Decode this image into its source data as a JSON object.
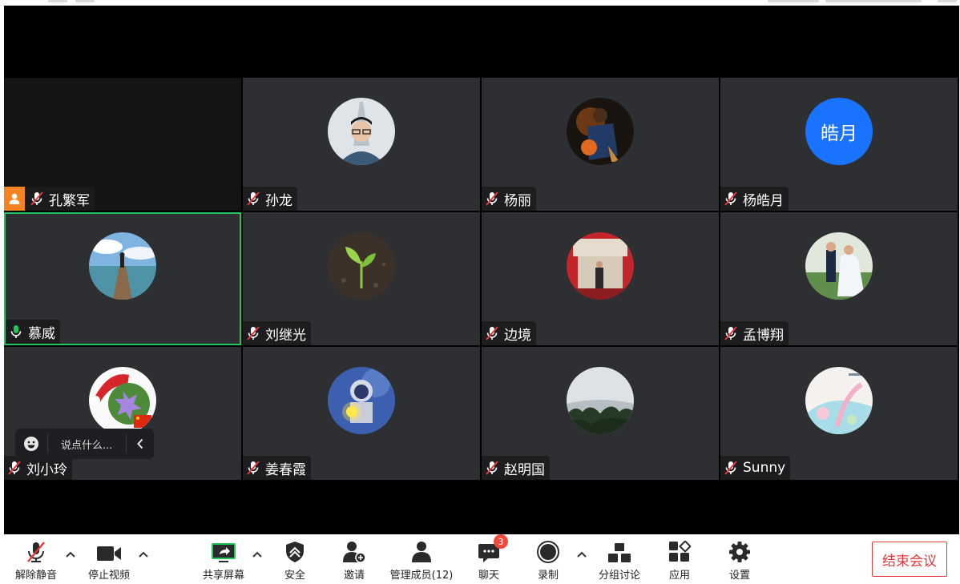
{
  "participants": [
    {
      "name": "孔繁军",
      "mic": "muted",
      "avatar": "none",
      "host_badge": true
    },
    {
      "name": "孙龙",
      "mic": "muted",
      "avatar": "photo-man-glasses"
    },
    {
      "name": "杨丽",
      "mic": "muted",
      "avatar": "photo-basketball"
    },
    {
      "name": "杨皓月",
      "mic": "muted",
      "avatar": "initials",
      "initials": "皓月"
    },
    {
      "name": "慕威",
      "mic": "speaking",
      "avatar": "photo-pier",
      "active": true
    },
    {
      "name": "刘继光",
      "mic": "muted",
      "avatar": "photo-sprout"
    },
    {
      "name": "边境",
      "mic": "muted",
      "avatar": "photo-building"
    },
    {
      "name": "孟博翔",
      "mic": "muted",
      "avatar": "photo-wedding"
    },
    {
      "name": "刘小玲",
      "mic": "muted",
      "avatar": "photo-flowers"
    },
    {
      "name": "姜春霞",
      "mic": "muted",
      "avatar": "photo-astronaut"
    },
    {
      "name": "赵明国",
      "mic": "muted",
      "avatar": "photo-mountain"
    },
    {
      "name": "Sunny",
      "mic": "muted",
      "avatar": "photo-pastel"
    }
  ],
  "chat_popup": {
    "placeholder": "说点什么..."
  },
  "toolbar": {
    "unmute": "解除静音",
    "stop_video": "停止视频",
    "share_screen": "共享屏幕",
    "security": "安全",
    "invite": "邀请",
    "participants": "管理成员(12)",
    "chat": "聊天",
    "chat_badge": "3",
    "record": "录制",
    "breakout": "分组讨论",
    "apps": "应用",
    "settings": "设置",
    "end_meeting": "结束会议"
  },
  "colors": {
    "accent_green": "#21c55d",
    "end_red": "#e5383b",
    "initials_blue": "#1a73ff",
    "badge_red": "#f0493e",
    "host_orange": "#f5831f"
  }
}
